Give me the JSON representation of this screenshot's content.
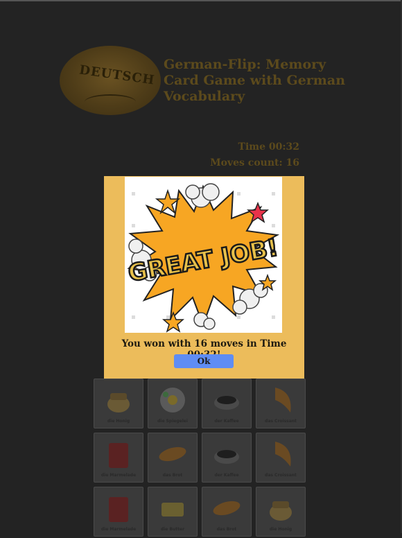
{
  "header": {
    "logo_text": "DEUTSCH",
    "title": "German-Flip: Memory Card Game with German Vocabulary"
  },
  "stats": {
    "time_label": "Time 00:32",
    "moves_label": "Moves count: 16"
  },
  "board": {
    "cards": [
      {
        "label": "die Honig",
        "icon": "honey-jar-icon"
      },
      {
        "label": "die Spiegelei",
        "icon": "fried-egg-icon"
      },
      {
        "label": "der Kaffee",
        "icon": "coffee-cup-icon"
      },
      {
        "label": "das Croissant",
        "icon": "croissant-icon"
      },
      {
        "label": "die Marmelade",
        "icon": "jam-jar-icon"
      },
      {
        "label": "das Brot",
        "icon": "bread-icon"
      },
      {
        "label": "der Kaffee",
        "icon": "coffee-cup-icon"
      },
      {
        "label": "das Croissant",
        "icon": "croissant-icon"
      },
      {
        "label": "die Marmelade",
        "icon": "jam-jar-icon"
      },
      {
        "label": "die Butter",
        "icon": "butter-icon"
      },
      {
        "label": "das Brot",
        "icon": "bread-icon"
      },
      {
        "label": "die Honig",
        "icon": "honey-jar-icon"
      }
    ]
  },
  "modal": {
    "burst_text": "GREAT JOB!",
    "message": "You won with 16 moves in Time 00:32!",
    "ok_label": "Ok"
  },
  "colors": {
    "background": "#232323",
    "modal": "#ecbc5b",
    "button": "#5f8df4",
    "burst_orange": "#f7a623",
    "burst_text": "#e8c14a"
  }
}
